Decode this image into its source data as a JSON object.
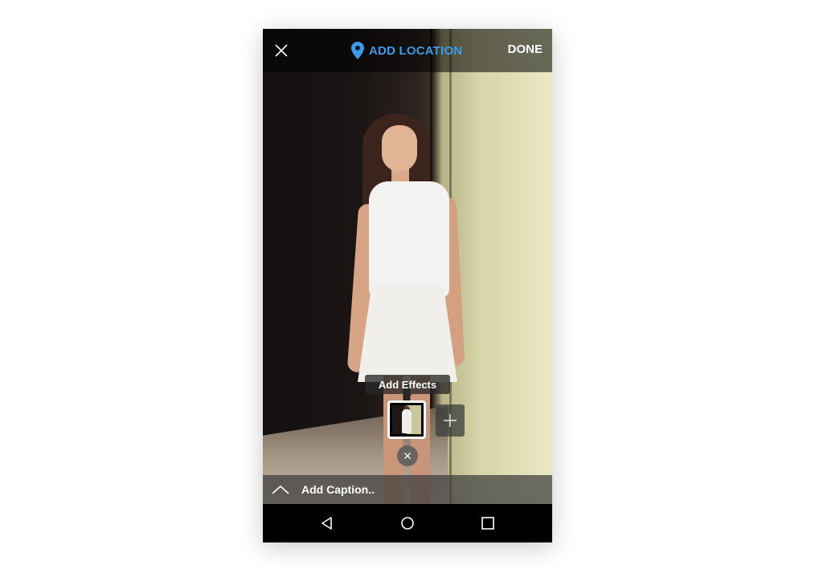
{
  "topbar": {
    "close_icon": "close-icon",
    "location_icon": "location-pin-icon",
    "location_label": "ADD LOCATION",
    "done_label": "DONE"
  },
  "effects": {
    "tooltip_label": "Add Effects",
    "add_icon": "plus-icon",
    "remove_icon": "close-icon"
  },
  "caption": {
    "chevron_icon": "chevron-up-icon",
    "placeholder": "Add Caption.."
  },
  "navbar": {
    "back_icon": "back-triangle-icon",
    "home_icon": "home-circle-icon",
    "recents_icon": "recents-square-icon"
  },
  "colors": {
    "accent": "#3d9be9",
    "topbar_bg": "rgba(0,0,0,0.55)",
    "navbar_bg": "#000000"
  }
}
